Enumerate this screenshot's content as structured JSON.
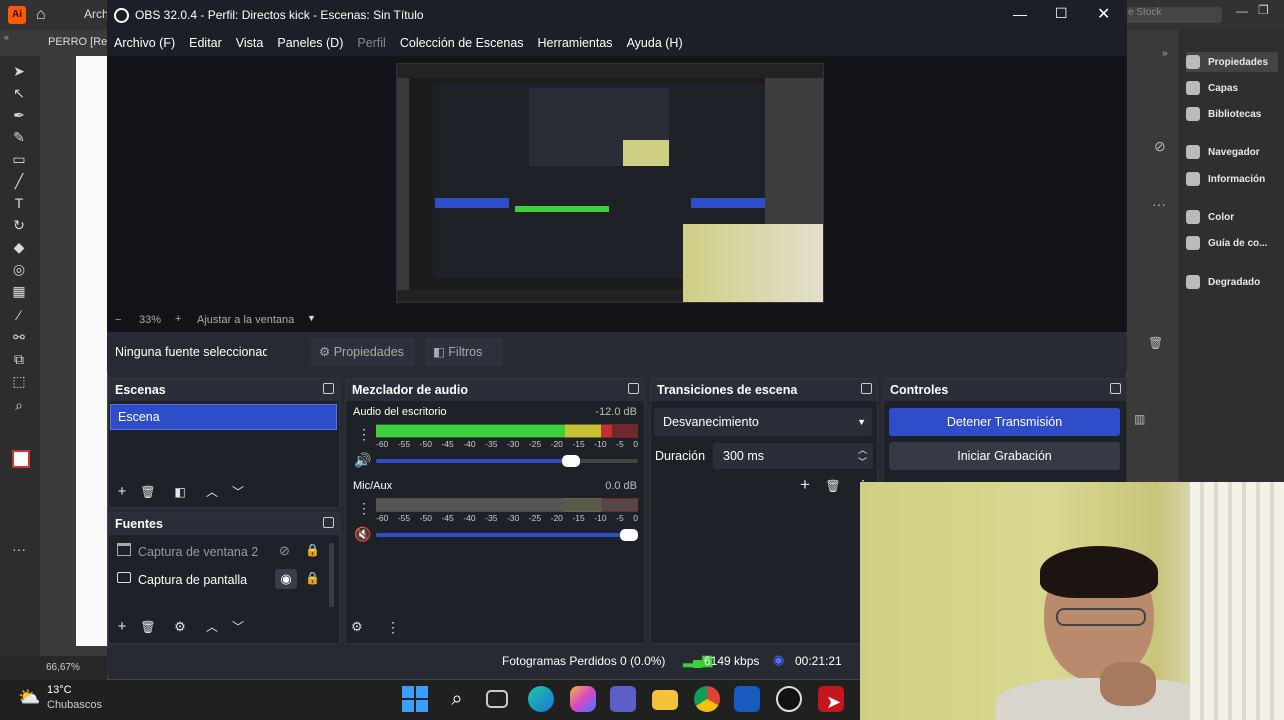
{
  "illustrator": {
    "tab_doc": "PERRO [Rec",
    "top_title_partial": "Arch",
    "stock_search": "e Stock",
    "zoom_level": "66,67%",
    "panels": [
      {
        "label": "Propiedades",
        "icon": "properties-icon"
      },
      {
        "label": "Capas",
        "icon": "layers-icon"
      },
      {
        "label": "Bibliotecas",
        "icon": "libraries-icon"
      },
      {
        "label": "Navegador",
        "icon": "navigator-icon"
      },
      {
        "label": "Información",
        "icon": "info-icon"
      },
      {
        "label": "Color",
        "icon": "color-icon"
      },
      {
        "label": "Guía de co...",
        "icon": "color-guide-icon"
      },
      {
        "label": "Degradado",
        "icon": "gradient-icon"
      }
    ]
  },
  "obs": {
    "title": "OBS 32.0.4 - Perfil: Directos kick - Escenas: Sin Título",
    "menu": [
      "Archivo (F)",
      "Editar",
      "Vista",
      "Paneles (D)",
      "Perfil",
      "Colección de Escenas",
      "Herramientas",
      "Ayuda (H)"
    ],
    "zoom": {
      "minus": "−",
      "value": "33%",
      "plus": "+",
      "fit_label": "Ajustar a la ventana"
    },
    "source_bar": {
      "no_source": "Ninguna fuente seleccionad",
      "properties": "Propiedades",
      "filters": "Filtros"
    },
    "scenes": {
      "title": "Escenas",
      "items": [
        "Escena"
      ]
    },
    "sources": {
      "title": "Fuentes",
      "items": [
        {
          "name": "Captura de ventana 2",
          "visible": false
        },
        {
          "name": "Captura de pantalla",
          "visible": true
        }
      ]
    },
    "mixer": {
      "title": "Mezclador de audio",
      "channels": [
        {
          "name": "Audio del escritorio",
          "db": "-12.0 dB",
          "level": 0.9,
          "volume": 0.78,
          "muted": false
        },
        {
          "name": "Mic/Aux",
          "db": "0.0 dB",
          "level": 0.0,
          "volume": 1.0,
          "muted": true
        }
      ],
      "ticks": [
        "-60",
        "-55",
        "-50",
        "-45",
        "-40",
        "-35",
        "-30",
        "-25",
        "-20",
        "-15",
        "-10",
        "-5",
        "0"
      ]
    },
    "transitions": {
      "title": "Transiciones de escena",
      "selected": "Desvanecimiento",
      "duration_label": "Duración",
      "duration_value": "300 ms"
    },
    "controls": {
      "title": "Controles",
      "stop_stream": "Detener Transmisión",
      "start_rec": "Iniciar Grabación"
    },
    "status": {
      "dropped": "Fotogramas Perdidos 0 (0.0%)",
      "bitrate": "6149 kbps",
      "time": "00:21:21"
    }
  },
  "taskbar": {
    "weather_temp": "13°C",
    "weather_desc": "Chubascos",
    "apps": [
      "windows-start-icon",
      "search-icon",
      "task-view-icon",
      "edge-icon",
      "copilot-icon",
      "teams-icon",
      "file-explorer-icon",
      "chrome-icon",
      "word-icon",
      "obs-icon",
      "acrobat-icon"
    ]
  },
  "colors": {
    "accent_blue": "#2f4dc9",
    "obs_bg": "#272a33",
    "meter_green": "#3bd13b",
    "meter_yellow": "#c7c232",
    "meter_red": "#c23030"
  }
}
